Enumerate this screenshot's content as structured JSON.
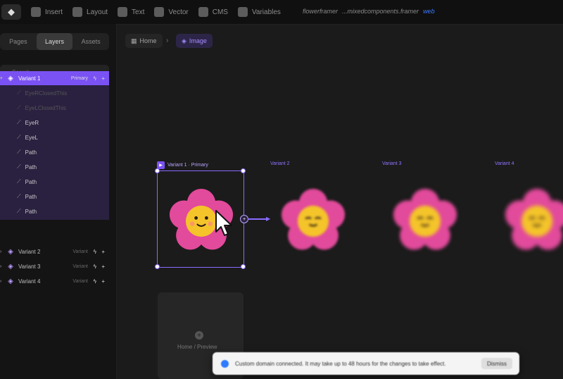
{
  "topbar": {
    "items": [
      {
        "label": "Insert",
        "icon": "insert-icon"
      },
      {
        "label": "Layout",
        "icon": "layout-icon"
      },
      {
        "label": "Text",
        "icon": "text-icon"
      },
      {
        "label": "Vector",
        "icon": "vector-icon"
      },
      {
        "label": "CMS",
        "icon": "cms-icon"
      },
      {
        "label": "Variables",
        "icon": "variables-icon"
      }
    ],
    "project": "flowerframer",
    "url": "...mixedcomponents.framer",
    "link": "web"
  },
  "sidebar": {
    "tabs": [
      "Pages",
      "Layers",
      "Assets"
    ],
    "active_tab": "Layers",
    "search_placeholder": "Search...",
    "variants": [
      {
        "label": "Variant 1",
        "tag": "Primary",
        "selected": true
      },
      {
        "label": "Variant 2",
        "tag": "Variant",
        "selected": false
      },
      {
        "label": "Variant 3",
        "tag": "Variant",
        "selected": false
      },
      {
        "label": "Variant 4",
        "tag": "Variant",
        "selected": false
      }
    ],
    "children": [
      "EyeRClosedThis",
      "EyeLClosedThis",
      "EyeR",
      "EyeL",
      "Path",
      "Path",
      "Path",
      "Path",
      "Path"
    ]
  },
  "breadcrumb": {
    "home": "Home",
    "current": "Image"
  },
  "canvas": {
    "frame_labels": [
      "Variant 1 · Primary",
      "Variant 2",
      "Variant 3",
      "Variant 4"
    ],
    "preview_label": "Home / Preview"
  },
  "toast": {
    "message": "Custom domain connected. It may take up to 48 hours for the changes to take effect.",
    "button": "Dismiss"
  },
  "colors": {
    "accent": "#7a52f4",
    "petal": "#e24a9b",
    "face": "#f4c42a"
  }
}
